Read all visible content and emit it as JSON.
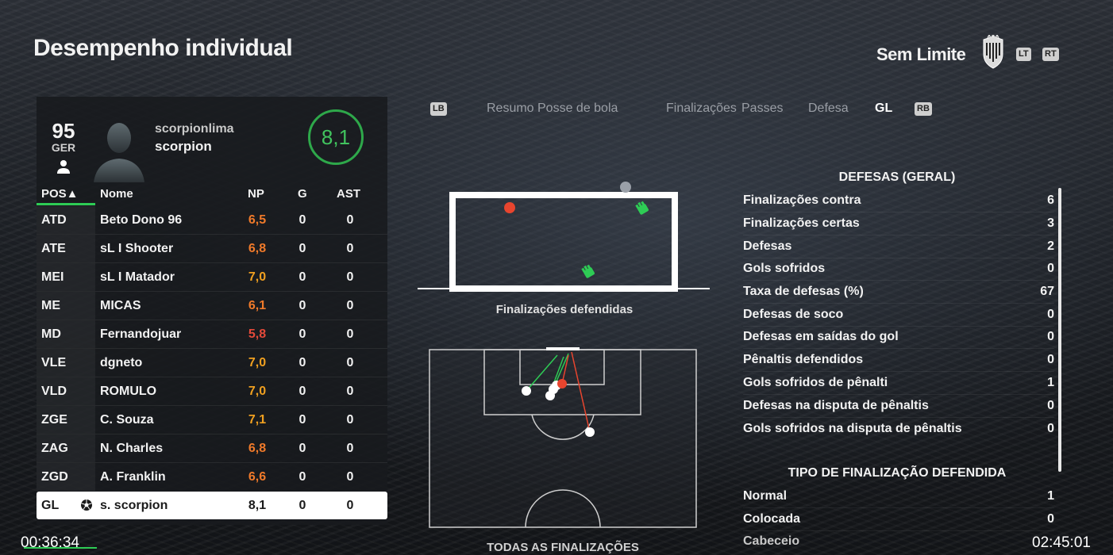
{
  "header": {
    "title": "Desempenho individual",
    "mode": "Sem Limite",
    "lt_label": "LT",
    "rt_label": "RT"
  },
  "player": {
    "overall": "95",
    "overall_label": "GER",
    "username": "scorpionlima",
    "name": "scorpion",
    "rating": "8,1",
    "rating_color": "#41c45e"
  },
  "table": {
    "headers": {
      "pos": "POS▲",
      "name": "Nome",
      "np": "NP",
      "g": "G",
      "ast": "AST"
    },
    "rows": [
      {
        "pos": "ATD",
        "name": "Beto Dono 96",
        "np": "6,5",
        "g": "0",
        "ast": "0",
        "np_color": "#f07a2a"
      },
      {
        "pos": "ATE",
        "name": "sL I Shooter",
        "np": "6,8",
        "g": "0",
        "ast": "0",
        "np_color": "#f07a2a"
      },
      {
        "pos": "MEI",
        "name": "sL I Matador",
        "np": "7,0",
        "g": "0",
        "ast": "0",
        "np_color": "#f0a020"
      },
      {
        "pos": "ME",
        "name": "MICAS",
        "np": "6,1",
        "g": "0",
        "ast": "0",
        "np_color": "#f07a2a"
      },
      {
        "pos": "MD",
        "name": "Fernandojuar",
        "np": "5,8",
        "g": "0",
        "ast": "0",
        "np_color": "#e54a3a"
      },
      {
        "pos": "VLE",
        "name": "dgneto",
        "np": "7,0",
        "g": "0",
        "ast": "0",
        "np_color": "#f0a020"
      },
      {
        "pos": "VLD",
        "name": "ROMULO",
        "np": "7,0",
        "g": "0",
        "ast": "0",
        "np_color": "#f0a020"
      },
      {
        "pos": "ZGE",
        "name": "C. Souza",
        "np": "7,1",
        "g": "0",
        "ast": "0",
        "np_color": "#f0a020"
      },
      {
        "pos": "ZAG",
        "name": "N. Charles",
        "np": "6,8",
        "g": "0",
        "ast": "0",
        "np_color": "#f07a2a"
      },
      {
        "pos": "ZGD",
        "name": "A. Franklin",
        "np": "6,6",
        "g": "0",
        "ast": "0",
        "np_color": "#f07a2a"
      },
      {
        "pos": "GL",
        "name": "s. scorpion",
        "np": "8,1",
        "g": "0",
        "ast": "0",
        "np_color": "#1a1a1a"
      }
    ]
  },
  "tabs": {
    "lb": "LB",
    "rb": "RB",
    "items": [
      "Resumo",
      "Posse de bola",
      "Finalizações",
      "Passes",
      "Defesa",
      "GL"
    ],
    "active": "GL"
  },
  "goal_chart": {
    "label": "Finalizações defendidas"
  },
  "pitch_chart": {
    "label": "TODAS AS FINALIZAÇÕES"
  },
  "stats": {
    "title": "DEFESAS (GERAL)",
    "items": [
      {
        "label": "Finalizações contra",
        "value": "6"
      },
      {
        "label": "Finalizações certas",
        "value": "3"
      },
      {
        "label": "Defesas",
        "value": "2"
      },
      {
        "label": "Gols sofridos",
        "value": "0"
      },
      {
        "label": "Taxa de defesas (%)",
        "value": "67"
      },
      {
        "label": "Defesas de soco",
        "value": "0"
      },
      {
        "label": "Defesas em saídas do gol",
        "value": "0"
      },
      {
        "label": "Pênaltis defendidos",
        "value": "0"
      },
      {
        "label": "Gols sofridos de pênalti",
        "value": "1"
      },
      {
        "label": "Defesas na disputa de pênaltis",
        "value": "0"
      },
      {
        "label": "Gols sofridos na disputa de pênaltis",
        "value": "0"
      }
    ]
  },
  "shot_types": {
    "title": "TIPO DE FINALIZAÇÃO DEFENDIDA",
    "items": [
      {
        "label": "Normal",
        "value": "1"
      },
      {
        "label": "Colocada",
        "value": "0"
      },
      {
        "label": "Cabeceio",
        "value": ""
      }
    ]
  },
  "clock": {
    "left": "00:36:34",
    "right": "02:45:01"
  }
}
